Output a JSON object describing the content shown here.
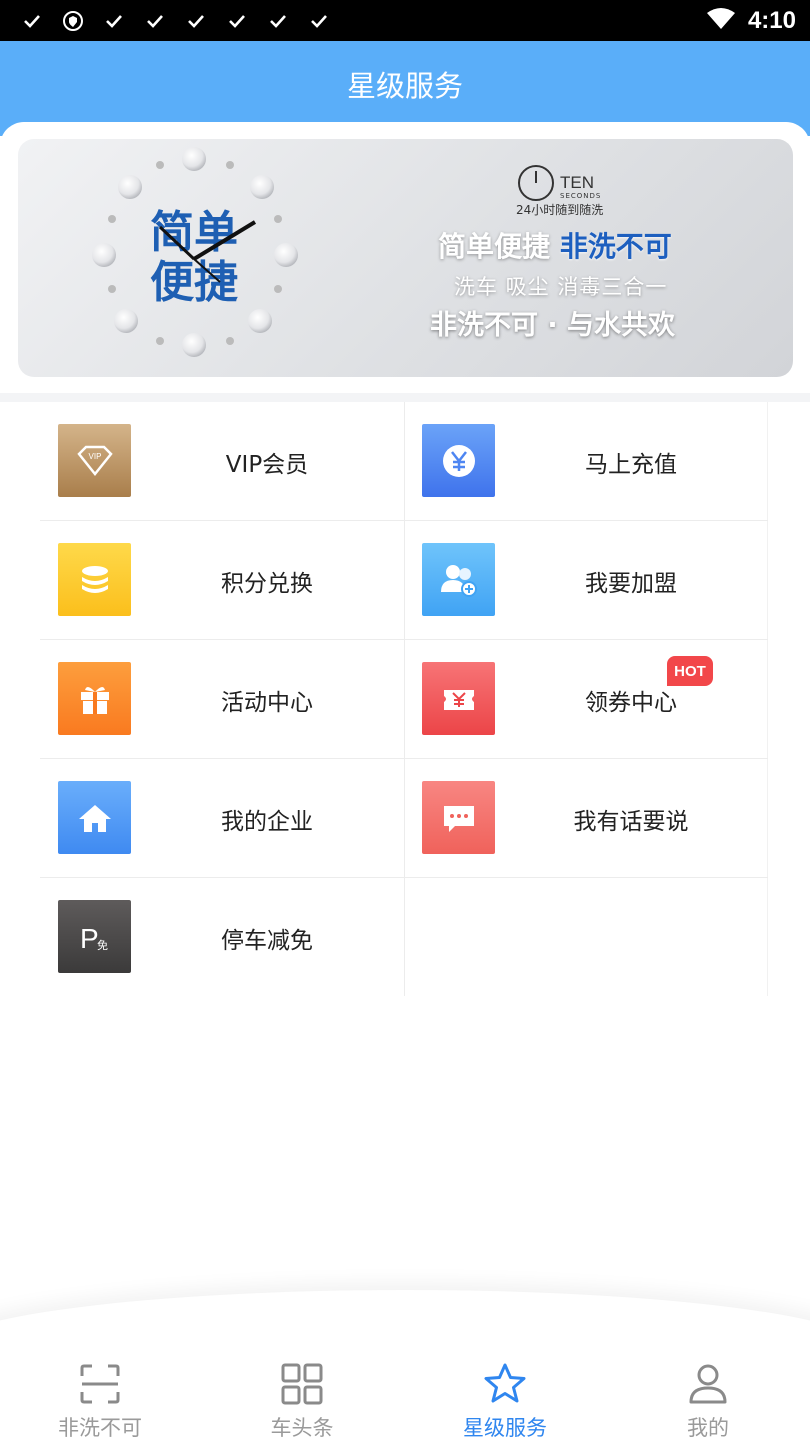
{
  "status_bar": {
    "time": "4:10"
  },
  "header": {
    "title": "星级服务"
  },
  "banner": {
    "clock_text_line1": "简单",
    "clock_text_line2": "便捷",
    "brand_name": "TEN",
    "brand_sub": "SECONDS",
    "brand_tag": "24小时随到随洗",
    "line1_a": "简单便捷",
    "line1_b": "非洗不可",
    "line2": "洗车 吸尘 消毒三合一",
    "line3": "非洗不可 · 与水共欢"
  },
  "services": [
    {
      "label": "VIP会员",
      "icon": "vip-diamond-icon",
      "color": "#b88d5a"
    },
    {
      "label": "马上充值",
      "icon": "yuan-coin-icon",
      "color": "#4e86f2"
    },
    {
      "label": "积分兑换",
      "icon": "coin-stack-icon",
      "color": "#fdc72f"
    },
    {
      "label": "我要加盟",
      "icon": "add-user-icon",
      "color": "#4fb0f7"
    },
    {
      "label": "活动中心",
      "icon": "gift-icon",
      "color": "#fb8b2b"
    },
    {
      "label": "领券中心",
      "icon": "coupon-icon",
      "color": "#f0575a",
      "badge": "HOT"
    },
    {
      "label": "我的企业",
      "icon": "home-icon",
      "color": "#4e9bf5"
    },
    {
      "label": "我有话要说",
      "icon": "chat-bubble-icon",
      "color": "#f36d66"
    },
    {
      "label": "停车减免",
      "icon": "parking-icon",
      "color": "#4a4a4a"
    }
  ],
  "bottom_nav": [
    {
      "label": "非洗不可",
      "icon": "scan-icon",
      "active": false
    },
    {
      "label": "车头条",
      "icon": "grid-icon",
      "active": false
    },
    {
      "label": "星级服务",
      "icon": "star-icon",
      "active": true
    },
    {
      "label": "我的",
      "icon": "person-icon",
      "active": false
    }
  ],
  "colors": {
    "header": "#5aaef9",
    "active_nav": "#2f86ef",
    "hot_badge": "#f2474a"
  }
}
